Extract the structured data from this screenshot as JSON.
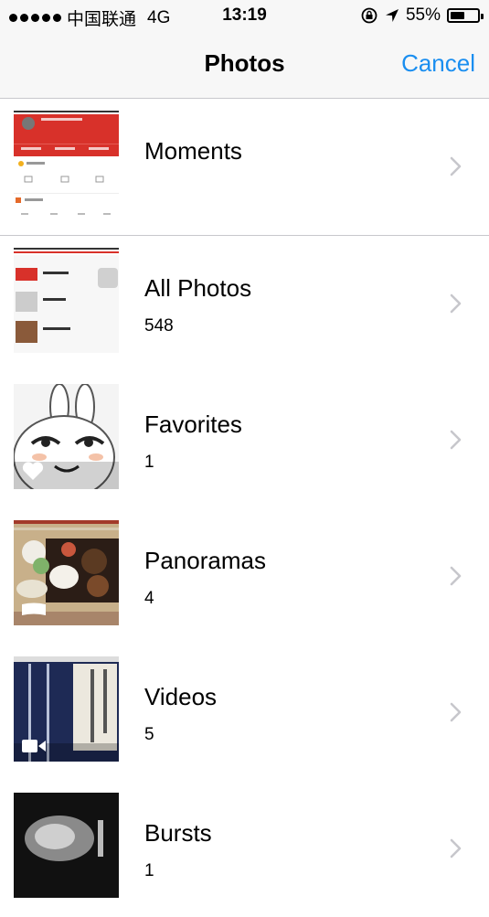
{
  "status_bar": {
    "carrier": "中国联通",
    "network": "4G",
    "time": "13:19",
    "battery_percent": "55%",
    "battery_level": 0.55
  },
  "nav": {
    "title": "Photos",
    "cancel_label": "Cancel"
  },
  "albums": [
    {
      "name": "Moments",
      "count": ""
    },
    {
      "name": "All Photos",
      "count": "548"
    },
    {
      "name": "Favorites",
      "count": "1"
    },
    {
      "name": "Panoramas",
      "count": "4"
    },
    {
      "name": "Videos",
      "count": "5"
    },
    {
      "name": "Bursts",
      "count": "1"
    }
  ],
  "colors": {
    "accent": "#1a8ef0",
    "separator": "#c8c8cc",
    "bar_background": "#f7f7f7",
    "chevron": "#c7c7cc"
  }
}
